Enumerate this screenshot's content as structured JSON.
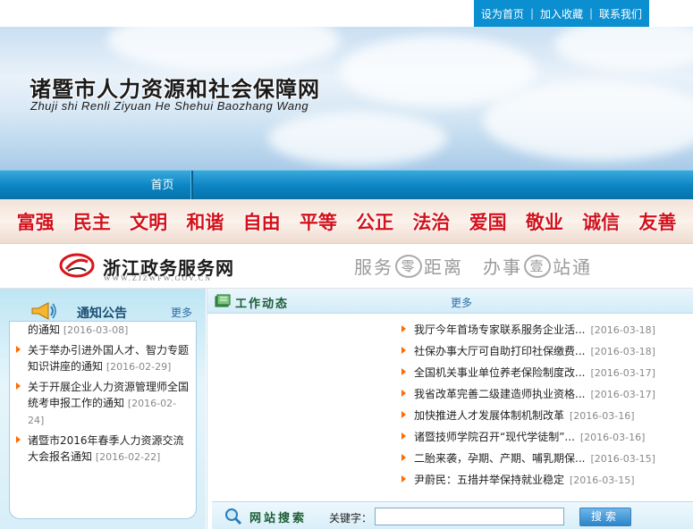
{
  "top_links": [
    {
      "label": "设为首页"
    },
    {
      "label": "加入收藏"
    },
    {
      "label": "联系我们"
    }
  ],
  "top_separator": "|",
  "banner": {
    "title": "诸暨市人力资源和社会保障网",
    "subtitle": "Zhuji shi Renli Ziyuan He Shehui Baozhang Wang"
  },
  "nav": {
    "items": [
      {
        "label": "首页"
      }
    ]
  },
  "core_values": [
    "富强",
    "民主",
    "文明",
    "和谐",
    "自由",
    "平等",
    "公正",
    "法治",
    "爱国",
    "敬业",
    "诚信",
    "友善"
  ],
  "zjzwfw": {
    "name": "浙江政务服务网",
    "url": "WWW.ZJZWFW.GOV.CN",
    "slogan_a": "服务",
    "slogan_circle_a": "零",
    "slogan_b": "距离",
    "slogan_c": "办事",
    "slogan_circle_b": "壹",
    "slogan_d": "站通"
  },
  "notices": {
    "title": "通知公告",
    "more": "更多",
    "items": [
      {
        "text": "关于开展诸暨市技能人才调查工作的通知",
        "date": "[2016-03-08]"
      },
      {
        "text": "关于举办引进外国人才、智力专题知识讲座的通知",
        "date": "[2016-02-29]"
      },
      {
        "text": "关于开展企业人力资源管理师全国统考申报工作的通知",
        "date": "[2016-02-24]"
      },
      {
        "text": "诸暨市2016年春季人力资源交流大会报名通知",
        "date": "[2016-02-22]"
      }
    ]
  },
  "news": {
    "title": "工作动态",
    "more": "更多",
    "items": [
      {
        "text": "我厅今年首场专家联系服务企业活...",
        "date": "[2016-03-18]"
      },
      {
        "text": "社保办事大厅可自助打印社保缴费...",
        "date": "[2016-03-18]"
      },
      {
        "text": "全国机关事业单位养老保险制度改...",
        "date": "[2016-03-17]"
      },
      {
        "text": "我省改革完善二级建造师执业资格...",
        "date": "[2016-03-17]"
      },
      {
        "text": "加快推进人才发展体制机制改革",
        "date": "[2016-03-16]"
      },
      {
        "text": "诸暨技师学院召开“现代学徒制”...",
        "date": "[2016-03-16]"
      },
      {
        "text": "二胎来袭，孕期、产期、哺乳期保...",
        "date": "[2016-03-15]"
      },
      {
        "text": "尹蔚民：五措并举保持就业稳定",
        "date": "[2016-03-15]"
      }
    ]
  },
  "search": {
    "title": "网站搜索",
    "label": "关键字：",
    "input_value": "",
    "placeholder": "",
    "button": "搜索"
  },
  "colors": {
    "top_bar": "#0c8fd0",
    "nav": "#0b84c2",
    "values_text": "#d3121b",
    "bullet": "#ff6a00"
  },
  "icons": [
    "speaker-icon",
    "book-icon",
    "search-magnifier-icon",
    "zjzwfw-logo-icon"
  ]
}
